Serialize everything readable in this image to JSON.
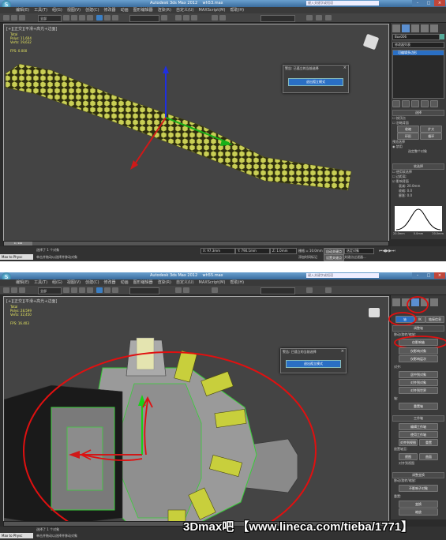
{
  "app": {
    "title": "Autodesk 3ds Max 2012",
    "file1": "wh53.max",
    "file2": "wh55.max",
    "search_placeholder": "键入关键字或短语"
  },
  "top": {
    "menus": [
      "编辑(E)",
      "工具(T)",
      "组(G)",
      "视图(V)",
      "创建(C)",
      "修改器",
      "动画",
      "图形编辑器",
      "渲染(R)",
      "自定义(U)",
      "MAXScript(M)",
      "帮助(H)"
    ],
    "selection_filter": "全部",
    "viewport_label": "[+][正交][平滑+高光+边面]",
    "stats": {
      "total": "Total",
      "polys": "Polys: 11,604",
      "verts": "Verts: 19,632",
      "fps": "FPS: 0.000"
    },
    "dialog": {
      "title": "警告: 已孤立的当前选择",
      "button": "退出孤立模式"
    },
    "panel": {
      "object_name": "Box006",
      "modifier_list": "修改器列表",
      "stack_item": "可编辑多边形",
      "rollouts": [
        "选择",
        "软选择"
      ],
      "soft_select": {
        "use": "使用软选择",
        "edge_distance": "边距离:",
        "affect_backfacing": "影响背面",
        "falloff": "衰减:",
        "pinch": "收缩:",
        "bubble": "膨胀:",
        "falloff_val": "20.0mm",
        "pinch_val": "0.0",
        "bubble_val": "0.0"
      },
      "curve_labels": [
        "20.0mm",
        "0.0mm",
        "20.0mm"
      ],
      "select_by_vertex": "按顶点",
      "ignore_backfacing": "忽略背面",
      "shrink": "收缩",
      "grow": "扩大",
      "ring": "环形",
      "loop": "循环",
      "preview_selection": "预览选择",
      "disabled": "禁用",
      "object_selected": "选定整个对象"
    },
    "status": {
      "selected": "选择了 1 个对象",
      "prompt": "单击并拖动以选择并移动对象",
      "frame": "0 / 100",
      "x": "X: 97.3mm",
      "y": "Y: 790.1mm",
      "z": "Z: 1.0mm",
      "grid": "栅格 = 10.0mm",
      "auto_key": "自动关键点",
      "selected_obj": "选定对象",
      "set_key": "设置关键点",
      "key_filters": "关键点过滤器...",
      "maxscript": "Max to Physc",
      "add_time_tag": "添加时间标记"
    }
  },
  "bottom": {
    "viewport_label": "[+][正交][平滑+高光+边面]",
    "stats": {
      "total": "Total",
      "polys": "Polys: 28,599",
      "verts": "Verts: 32,450",
      "fps": "FPS: 16.403"
    },
    "dialog": {
      "title": "警告: 已孤立的当前选择",
      "button": "退出孤立模式"
    },
    "panel": {
      "tabs": [
        "轴",
        "IK",
        "链接信息"
      ],
      "adjust_pivot": "调整轴",
      "move_rotate_scale": "移动/旋转/缩放:",
      "affect_pivot_only": "仅影响轴",
      "affect_object_only": "仅影响对象",
      "affect_hierarchy_only": "仅影响层次",
      "alignment": "对齐:",
      "center_to_object": "居中到对象",
      "align_to_object": "对齐到对象",
      "align_to_world": "对齐到世界",
      "pivot": "轴:",
      "reset_pivot": "重置轴",
      "working_pivot": "工作轴",
      "edit_working_pivot": "编辑工作轴",
      "use_working_pivot": "使用工作轴",
      "align_to_view": "对齐到视图",
      "reset": "重置",
      "place_pivot_to": "放置轴至:",
      "view": "视图",
      "surface": "曲面",
      "align_to_view_chk": "对齐到视图",
      "adjust_transform": "调整变换",
      "move_rotate_scale2": "移动/旋转/缩放:",
      "dont_affect_children": "不影响子对象",
      "reset_label": "重置:",
      "transform": "变换",
      "scale": "缩放"
    },
    "status": {
      "selected": "选择了 1 个对象",
      "prompt": "单击并拖动以选择并移动对象",
      "maxscript": "Max to Physc"
    }
  },
  "watermark": "3Dmax吧 【www.lineca.com/tieba/1771】",
  "colors": {
    "accent": "#2a6fc4",
    "annotation": "#e01010",
    "mesh": "#c8cf50",
    "viewport_bg": "#444444"
  }
}
